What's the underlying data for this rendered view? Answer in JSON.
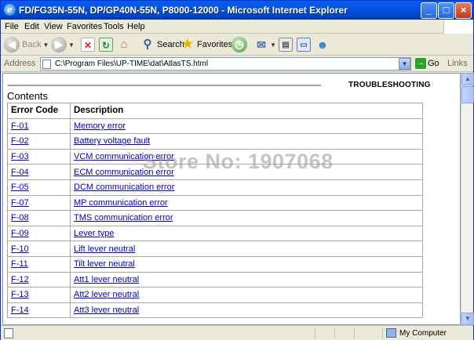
{
  "window": {
    "title": "FD/FG35N-55N, DP/GP40N-55N, P8000-12000 - Microsoft Internet Explorer",
    "minimize_glyph": "_",
    "maximize_glyph": "□",
    "close_glyph": "×"
  },
  "menu": [
    "File",
    "Edit",
    "View",
    "Favorites",
    "Tools",
    "Help"
  ],
  "toolbar": {
    "back_label": "Back",
    "search_label": "Search",
    "favorites_label": "Favorites"
  },
  "address": {
    "label": "Address",
    "value": "C:\\Program Files\\UP-TIME\\dat\\AtlasTS.html",
    "go_label": "Go",
    "links_label": "Links"
  },
  "page": {
    "section_header": "TROUBLESHOOTING",
    "contents_heading": "Contents",
    "watermark": "Store No: 1907068",
    "table": {
      "headers": [
        "Error Code",
        "Description"
      ],
      "rows": [
        {
          "code": "F-01",
          "description": "Memory error"
        },
        {
          "code": "F-02",
          "description": "Battery voltage fault"
        },
        {
          "code": "F-03",
          "description": "VCM communication error"
        },
        {
          "code": "F-04",
          "description": "ECM communication error"
        },
        {
          "code": "F-05",
          "description": "DCM communication error"
        },
        {
          "code": "F-07",
          "description": "MP communication error"
        },
        {
          "code": "F-08",
          "description": "TMS communication error"
        },
        {
          "code": "F-09",
          "description": "Lever type"
        },
        {
          "code": "F-10",
          "description": "Lift lever neutral"
        },
        {
          "code": "F-11",
          "description": "Tilt lever neutral"
        },
        {
          "code": "F-12",
          "description": "Att1 lever neutral"
        },
        {
          "code": "F-13",
          "description": "Att2 lever neutral"
        },
        {
          "code": "F-14",
          "description": "Att3 lever neutral"
        }
      ]
    }
  },
  "status": {
    "zone_label": "My Computer"
  },
  "colors": {
    "titlebar": "#0054e3",
    "link": "#0000cc",
    "chrome": "#ece9d8"
  }
}
